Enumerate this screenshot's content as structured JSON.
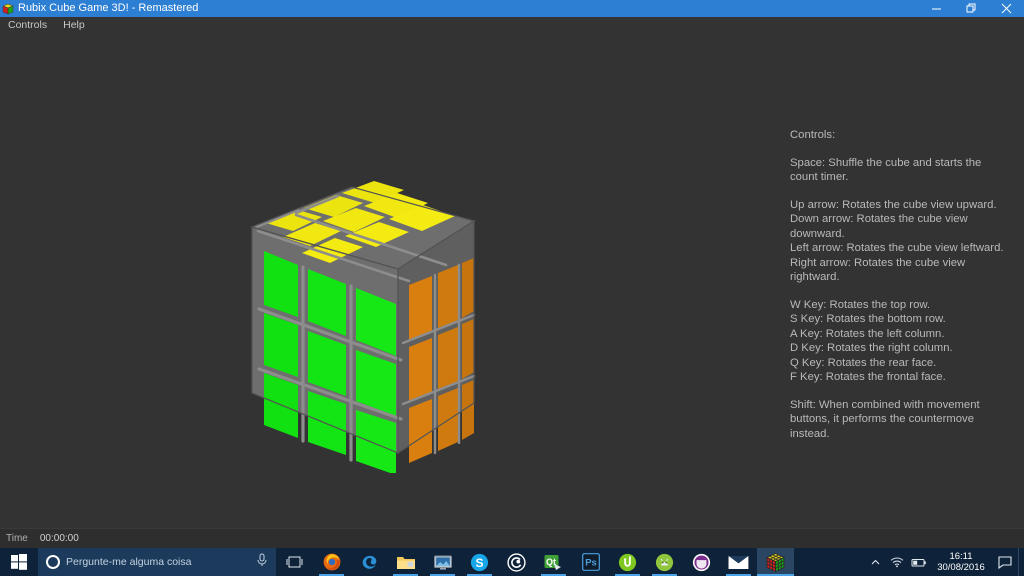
{
  "window": {
    "title": "Rubix Cube Game 3D! - Remastered",
    "icon": "rubik-cube-icon",
    "titlebar_color": "#2d7fd3",
    "controls": {
      "minimize": "minimize-icon",
      "maximize": "restore-icon",
      "close": "close-icon"
    }
  },
  "menubar": {
    "items": [
      {
        "label": "Controls"
      },
      {
        "label": "Help"
      }
    ]
  },
  "canvas": {
    "background_color": "#333333",
    "cube": {
      "type": "rubiks-cube-3d",
      "size": "3x3x3",
      "state": "solved",
      "faces": {
        "top": {
          "color": "#f2e712",
          "name": "yellow"
        },
        "front": {
          "color": "#12e012",
          "name": "green"
        },
        "right": {
          "color": "#d98010",
          "name": "orange"
        }
      },
      "frame_color": "#707070"
    }
  },
  "instructions": {
    "heading": "Controls:",
    "blocks": [
      {
        "lines": [
          "Space: Shuffle the cube and starts the",
          "count timer."
        ]
      },
      {
        "lines": [
          "Up arrow: Rotates the cube view upward.",
          "Down arrow: Rotates the cube view",
          "downward.",
          "Left arrow: Rotates the cube view leftward.",
          "Right arrow: Rotates the cube view",
          "rightward."
        ]
      },
      {
        "lines": [
          "W Key: Rotates the top row.",
          "S Key: Rotates the bottom row.",
          "A Key: Rotates the left column.",
          "D Key: Rotates the right column.",
          "Q Key: Rotates the rear face.",
          "F Key: Rotates the frontal face."
        ]
      },
      {
        "lines": [
          "Shift: When combined with movement",
          "buttons, it performs the countermove",
          "instead."
        ]
      }
    ]
  },
  "statusbar": {
    "time_label": "Time",
    "time_value": "00:00:00"
  },
  "taskbar": {
    "start": "windows-logo-icon",
    "search": {
      "placeholder": "Pergunte-me alguma coisa",
      "circle_icon": "cortana-circle-icon",
      "mic_icon": "microphone-icon"
    },
    "items": [
      {
        "name": "task-view-icon",
        "label": "Task View"
      },
      {
        "name": "firefox-icon",
        "label": "Mozilla Firefox"
      },
      {
        "name": "edge-icon",
        "label": "Microsoft Edge"
      },
      {
        "name": "file-explorer-icon",
        "label": "File Explorer"
      },
      {
        "name": "monitor-app-icon",
        "label": "Monitor"
      },
      {
        "name": "skype-icon",
        "label": "Skype"
      },
      {
        "name": "spiral-app-icon",
        "label": "Spiral"
      },
      {
        "name": "qt-creator-icon",
        "label": "Qt Creator"
      },
      {
        "name": "photoshop-icon",
        "label": "Photoshop"
      },
      {
        "name": "utorrent-icon",
        "label": "uTorrent"
      },
      {
        "name": "android-studio-icon",
        "label": "Android Studio"
      },
      {
        "name": "purple-app-icon",
        "label": "App"
      },
      {
        "name": "mail-icon",
        "label": "Mail"
      },
      {
        "name": "rubik-cube-app-icon",
        "label": "Rubix Cube Game 3D!"
      }
    ],
    "tray": {
      "chevron": "chevron-up-icon",
      "network": "wifi-icon",
      "battery": "battery-icon",
      "time": "16:11",
      "date": "30/08/2016",
      "action_center": "action-center-icon"
    }
  }
}
